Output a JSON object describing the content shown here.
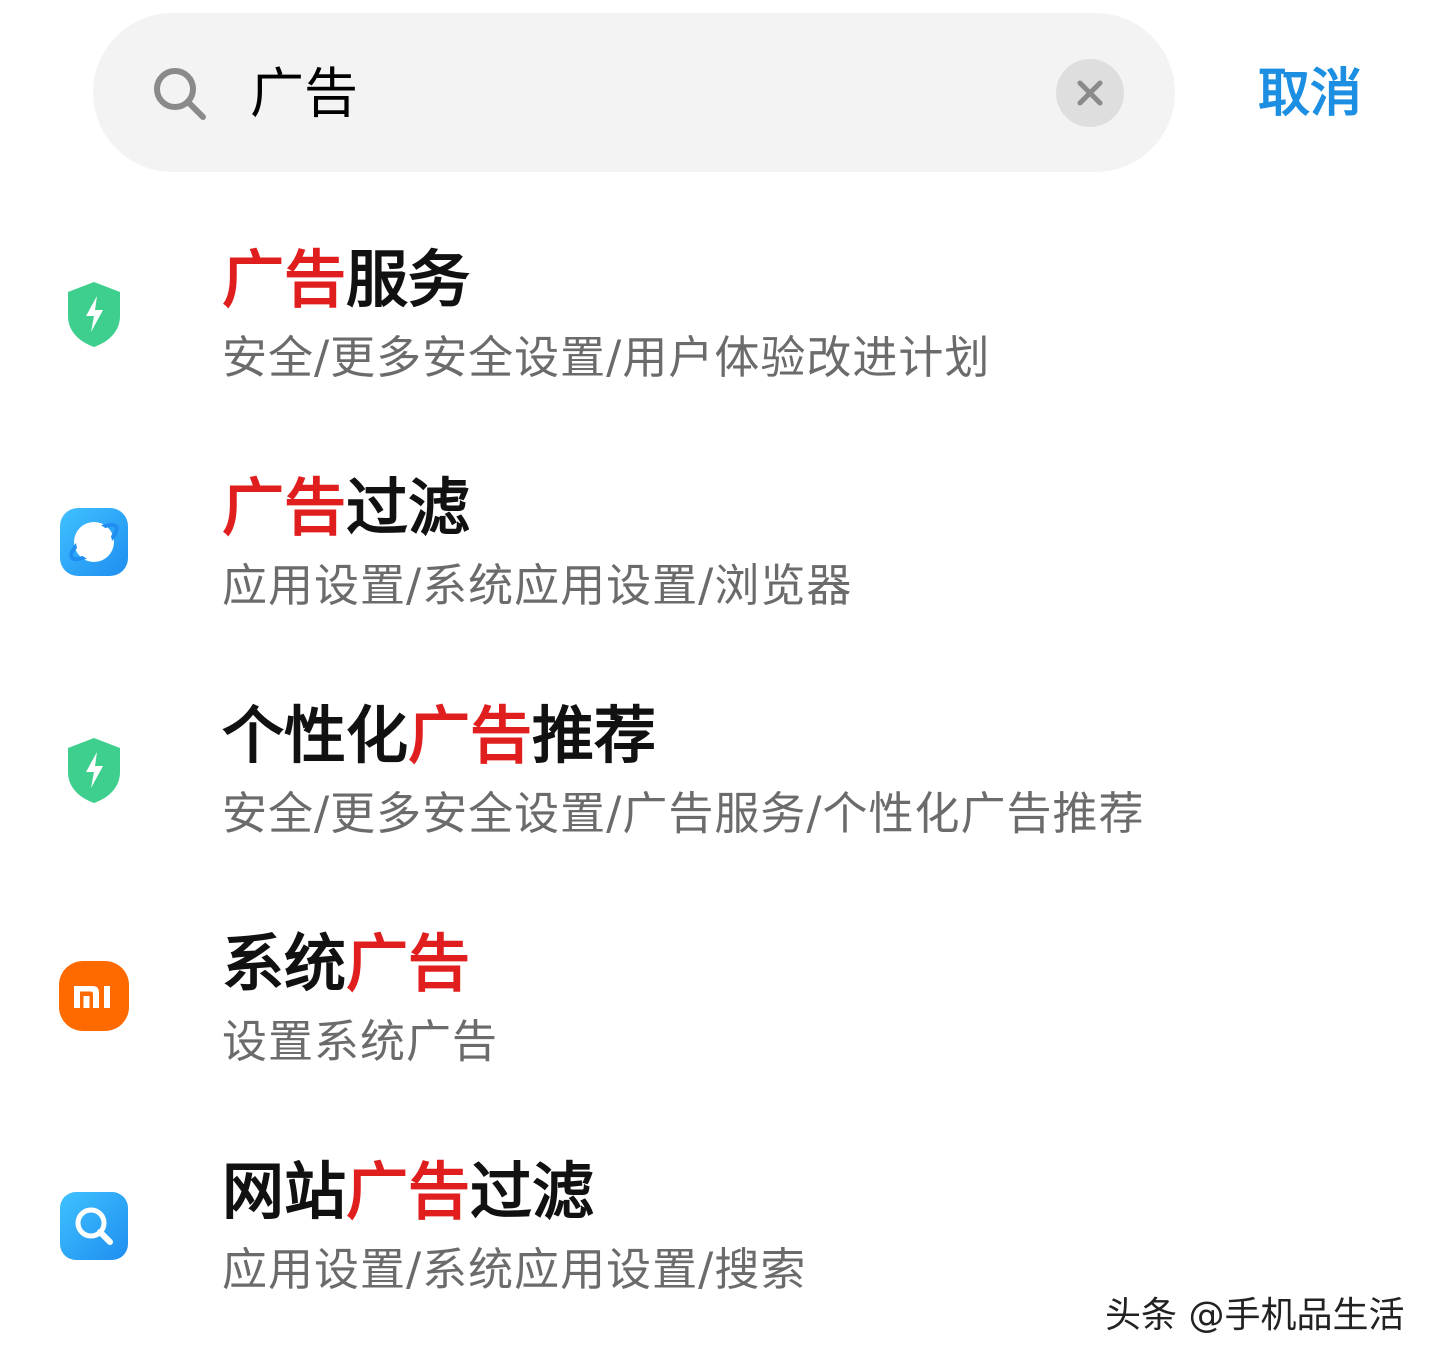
{
  "search": {
    "query": "广告",
    "cancel_label": "取消"
  },
  "results": [
    {
      "icon": "security-shield-icon",
      "icon_color": "#3ecf8e",
      "title_parts": [
        "",
        "广告",
        "服务"
      ],
      "path": "安全/更多安全设置/用户体验改进计划"
    },
    {
      "icon": "browser-icon",
      "icon_color": "#27a7f5",
      "title_parts": [
        "",
        "广告",
        "过滤"
      ],
      "path": "应用设置/系统应用设置/浏览器"
    },
    {
      "icon": "security-shield-icon",
      "icon_color": "#3ecf8e",
      "title_parts": [
        "个性化",
        "广告",
        "推荐"
      ],
      "path": "安全/更多安全设置/广告服务/个性化广告推荐"
    },
    {
      "icon": "mi-logo-icon",
      "icon_color": "#ff6a00",
      "title_parts": [
        "系统",
        "广告",
        ""
      ],
      "path": "设置系统广告"
    },
    {
      "icon": "search-app-icon",
      "icon_color": "#27a7f5",
      "title_parts": [
        "网站",
        "广告",
        "过滤"
      ],
      "path": "应用设置/系统应用设置/搜索"
    }
  ],
  "colors": {
    "highlight": "#e01e1e",
    "accent": "#1d8fe3"
  },
  "watermark": "头条 @手机品生活"
}
